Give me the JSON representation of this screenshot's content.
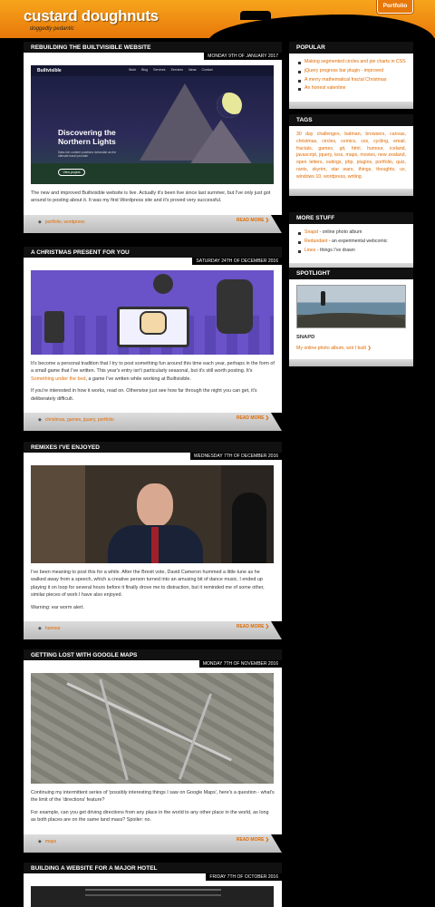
{
  "site": {
    "title": "custard doughnuts",
    "subtitle": "doggedly pedantic",
    "portfolio_label": "Portfolio"
  },
  "posts": [
    {
      "title": "Rebuilding the Builtvisible website",
      "date": "Monday 9th of January 2017",
      "image": {
        "brand": "Builtvisible",
        "headline": "Discovering the Northern Lights",
        "sub": "Data-rich content positions Icelandair as the ultimate travel provider",
        "cta": "View project",
        "nav": [
          "Work",
          "Blog",
          "Services",
          "Services",
          "Ideas",
          "Contact"
        ]
      },
      "paragraphs": [
        "The new and improved Builtvisible website is live. Actually it's been live since last summer, but I've only just got around to posting about it. It was my first Wordpress site and it's proved very successful."
      ],
      "tags": "portfolio, wordpress",
      "read_more": "READ MORE"
    },
    {
      "title": "A Christmas present for you",
      "date": "Saturday 24th of December 2016",
      "paragraphs": [
        "It's become a personal tradition that I try to post something fun around this time each year, perhaps in the form of a small game that I've written. This year's entry isn't particularly seasonal, but it's still worth posting. It's Something under the bed, a game I've written while working at Builtvisible.",
        "If you're interested in how it works, read on. Otherwise just see how far through the night you can get, it's deliberately difficult."
      ],
      "link_text": "Something under the bed",
      "tags": "christmas, games, jquery, portfolio",
      "read_more": "READ MORE"
    },
    {
      "title": "Remixes I've enjoyed",
      "date": "Wednesday 7th of December 2016",
      "paragraphs": [
        "I've been meaning to post this for a while. After the Brexit vote, David Cameron hummed a little tune as he walked away from a speech, which a creative person turned into an amusing bit of dance music. I ended up playing it on loop for several hours before it finally drove me to distraction, but it reminded me of some other, similar pieces of work I have also enjoyed.",
        "Warning: ear worm alert."
      ],
      "tags": "humour",
      "read_more": "READ MORE"
    },
    {
      "title": "Getting lost with Google Maps",
      "date": "Monday 7th of November 2016",
      "paragraphs": [
        "Continuing my intermittent series of 'possibly interesting things I saw on Google Maps', here's a question - what's the limit of the 'directions' feature?",
        "For example, can you get driving directions from any place in the world to any other place in the world, as long as both places are on the same land mass? Spoiler: no."
      ],
      "tags": "maps",
      "read_more": "READ MORE"
    },
    {
      "title": "Building a website for a major hotel",
      "date": "Friday 7th of October 2016"
    }
  ],
  "sidebar": {
    "popular": {
      "title": "Popular",
      "items": [
        "Making segmented circles and pie charts in CSS",
        "jQuery progress bar plugin - improved",
        "A merry mathematical fractal Christmas",
        "An honest valentine"
      ]
    },
    "tags": {
      "title": "Tags",
      "text": "30 day challenges, batman, browsers, canvas, christmas, circles, comics, css, cycling, email, fractals, games, git, html, humour, iceland, javascript, jquery, less, maps, movies, new zealand, open letters, outings, php, plugins, portfolio, quiz, rants, skyrim, star wars, things, thoughts, ux, windows 10, wordpress, writing"
    },
    "more": {
      "title": "More stuff",
      "items": [
        {
          "link": "Snapd",
          "rest": " - online photo album"
        },
        {
          "link": "Redundant",
          "rest": " - an experimental webcomic"
        },
        {
          "link": "Lines",
          "rest": " - things I've drawn"
        }
      ]
    },
    "spotlight": {
      "title": "Spotlight",
      "name": "SNAPD",
      "caption": "My online photo album, wot I built"
    }
  }
}
